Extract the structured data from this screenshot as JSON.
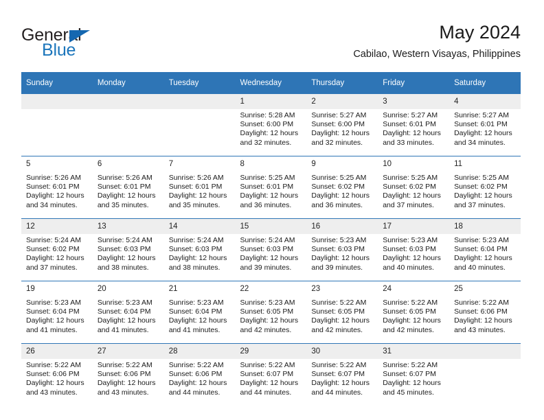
{
  "brand": {
    "name_part1": "General",
    "name_part2": "Blue"
  },
  "header": {
    "title": "May 2024",
    "subtitle": "Cabilao, Western Visayas, Philippines"
  },
  "colors": {
    "header_blue": "#2e75b6",
    "brand_blue": "#1b75bb",
    "row_band": "#eeeeee"
  },
  "weekday_headers": [
    "Sunday",
    "Monday",
    "Tuesday",
    "Wednesday",
    "Thursday",
    "Friday",
    "Saturday"
  ],
  "weeks": [
    {
      "shaded": true,
      "days": [
        {
          "num": "",
          "sunrise": "",
          "sunset": "",
          "daylight1": "",
          "daylight2": "",
          "empty": true
        },
        {
          "num": "",
          "sunrise": "",
          "sunset": "",
          "daylight1": "",
          "daylight2": "",
          "empty": true
        },
        {
          "num": "",
          "sunrise": "",
          "sunset": "",
          "daylight1": "",
          "daylight2": "",
          "empty": true
        },
        {
          "num": "1",
          "sunrise": "Sunrise: 5:28 AM",
          "sunset": "Sunset: 6:00 PM",
          "daylight1": "Daylight: 12 hours",
          "daylight2": "and 32 minutes.",
          "empty": false
        },
        {
          "num": "2",
          "sunrise": "Sunrise: 5:27 AM",
          "sunset": "Sunset: 6:00 PM",
          "daylight1": "Daylight: 12 hours",
          "daylight2": "and 32 minutes.",
          "empty": false
        },
        {
          "num": "3",
          "sunrise": "Sunrise: 5:27 AM",
          "sunset": "Sunset: 6:01 PM",
          "daylight1": "Daylight: 12 hours",
          "daylight2": "and 33 minutes.",
          "empty": false
        },
        {
          "num": "4",
          "sunrise": "Sunrise: 5:27 AM",
          "sunset": "Sunset: 6:01 PM",
          "daylight1": "Daylight: 12 hours",
          "daylight2": "and 34 minutes.",
          "empty": false
        }
      ]
    },
    {
      "shaded": false,
      "days": [
        {
          "num": "5",
          "sunrise": "Sunrise: 5:26 AM",
          "sunset": "Sunset: 6:01 PM",
          "daylight1": "Daylight: 12 hours",
          "daylight2": "and 34 minutes.",
          "empty": false
        },
        {
          "num": "6",
          "sunrise": "Sunrise: 5:26 AM",
          "sunset": "Sunset: 6:01 PM",
          "daylight1": "Daylight: 12 hours",
          "daylight2": "and 35 minutes.",
          "empty": false
        },
        {
          "num": "7",
          "sunrise": "Sunrise: 5:26 AM",
          "sunset": "Sunset: 6:01 PM",
          "daylight1": "Daylight: 12 hours",
          "daylight2": "and 35 minutes.",
          "empty": false
        },
        {
          "num": "8",
          "sunrise": "Sunrise: 5:25 AM",
          "sunset": "Sunset: 6:01 PM",
          "daylight1": "Daylight: 12 hours",
          "daylight2": "and 36 minutes.",
          "empty": false
        },
        {
          "num": "9",
          "sunrise": "Sunrise: 5:25 AM",
          "sunset": "Sunset: 6:02 PM",
          "daylight1": "Daylight: 12 hours",
          "daylight2": "and 36 minutes.",
          "empty": false
        },
        {
          "num": "10",
          "sunrise": "Sunrise: 5:25 AM",
          "sunset": "Sunset: 6:02 PM",
          "daylight1": "Daylight: 12 hours",
          "daylight2": "and 37 minutes.",
          "empty": false
        },
        {
          "num": "11",
          "sunrise": "Sunrise: 5:25 AM",
          "sunset": "Sunset: 6:02 PM",
          "daylight1": "Daylight: 12 hours",
          "daylight2": "and 37 minutes.",
          "empty": false
        }
      ]
    },
    {
      "shaded": true,
      "days": [
        {
          "num": "12",
          "sunrise": "Sunrise: 5:24 AM",
          "sunset": "Sunset: 6:02 PM",
          "daylight1": "Daylight: 12 hours",
          "daylight2": "and 37 minutes.",
          "empty": false
        },
        {
          "num": "13",
          "sunrise": "Sunrise: 5:24 AM",
          "sunset": "Sunset: 6:03 PM",
          "daylight1": "Daylight: 12 hours",
          "daylight2": "and 38 minutes.",
          "empty": false
        },
        {
          "num": "14",
          "sunrise": "Sunrise: 5:24 AM",
          "sunset": "Sunset: 6:03 PM",
          "daylight1": "Daylight: 12 hours",
          "daylight2": "and 38 minutes.",
          "empty": false
        },
        {
          "num": "15",
          "sunrise": "Sunrise: 5:24 AM",
          "sunset": "Sunset: 6:03 PM",
          "daylight1": "Daylight: 12 hours",
          "daylight2": "and 39 minutes.",
          "empty": false
        },
        {
          "num": "16",
          "sunrise": "Sunrise: 5:23 AM",
          "sunset": "Sunset: 6:03 PM",
          "daylight1": "Daylight: 12 hours",
          "daylight2": "and 39 minutes.",
          "empty": false
        },
        {
          "num": "17",
          "sunrise": "Sunrise: 5:23 AM",
          "sunset": "Sunset: 6:03 PM",
          "daylight1": "Daylight: 12 hours",
          "daylight2": "and 40 minutes.",
          "empty": false
        },
        {
          "num": "18",
          "sunrise": "Sunrise: 5:23 AM",
          "sunset": "Sunset: 6:04 PM",
          "daylight1": "Daylight: 12 hours",
          "daylight2": "and 40 minutes.",
          "empty": false
        }
      ]
    },
    {
      "shaded": false,
      "days": [
        {
          "num": "19",
          "sunrise": "Sunrise: 5:23 AM",
          "sunset": "Sunset: 6:04 PM",
          "daylight1": "Daylight: 12 hours",
          "daylight2": "and 41 minutes.",
          "empty": false
        },
        {
          "num": "20",
          "sunrise": "Sunrise: 5:23 AM",
          "sunset": "Sunset: 6:04 PM",
          "daylight1": "Daylight: 12 hours",
          "daylight2": "and 41 minutes.",
          "empty": false
        },
        {
          "num": "21",
          "sunrise": "Sunrise: 5:23 AM",
          "sunset": "Sunset: 6:04 PM",
          "daylight1": "Daylight: 12 hours",
          "daylight2": "and 41 minutes.",
          "empty": false
        },
        {
          "num": "22",
          "sunrise": "Sunrise: 5:23 AM",
          "sunset": "Sunset: 6:05 PM",
          "daylight1": "Daylight: 12 hours",
          "daylight2": "and 42 minutes.",
          "empty": false
        },
        {
          "num": "23",
          "sunrise": "Sunrise: 5:22 AM",
          "sunset": "Sunset: 6:05 PM",
          "daylight1": "Daylight: 12 hours",
          "daylight2": "and 42 minutes.",
          "empty": false
        },
        {
          "num": "24",
          "sunrise": "Sunrise: 5:22 AM",
          "sunset": "Sunset: 6:05 PM",
          "daylight1": "Daylight: 12 hours",
          "daylight2": "and 42 minutes.",
          "empty": false
        },
        {
          "num": "25",
          "sunrise": "Sunrise: 5:22 AM",
          "sunset": "Sunset: 6:06 PM",
          "daylight1": "Daylight: 12 hours",
          "daylight2": "and 43 minutes.",
          "empty": false
        }
      ]
    },
    {
      "shaded": true,
      "days": [
        {
          "num": "26",
          "sunrise": "Sunrise: 5:22 AM",
          "sunset": "Sunset: 6:06 PM",
          "daylight1": "Daylight: 12 hours",
          "daylight2": "and 43 minutes.",
          "empty": false
        },
        {
          "num": "27",
          "sunrise": "Sunrise: 5:22 AM",
          "sunset": "Sunset: 6:06 PM",
          "daylight1": "Daylight: 12 hours",
          "daylight2": "and 43 minutes.",
          "empty": false
        },
        {
          "num": "28",
          "sunrise": "Sunrise: 5:22 AM",
          "sunset": "Sunset: 6:06 PM",
          "daylight1": "Daylight: 12 hours",
          "daylight2": "and 44 minutes.",
          "empty": false
        },
        {
          "num": "29",
          "sunrise": "Sunrise: 5:22 AM",
          "sunset": "Sunset: 6:07 PM",
          "daylight1": "Daylight: 12 hours",
          "daylight2": "and 44 minutes.",
          "empty": false
        },
        {
          "num": "30",
          "sunrise": "Sunrise: 5:22 AM",
          "sunset": "Sunset: 6:07 PM",
          "daylight1": "Daylight: 12 hours",
          "daylight2": "and 44 minutes.",
          "empty": false
        },
        {
          "num": "31",
          "sunrise": "Sunrise: 5:22 AM",
          "sunset": "Sunset: 6:07 PM",
          "daylight1": "Daylight: 12 hours",
          "daylight2": "and 45 minutes.",
          "empty": false
        },
        {
          "num": "",
          "sunrise": "",
          "sunset": "",
          "daylight1": "",
          "daylight2": "",
          "empty": true
        }
      ]
    }
  ]
}
